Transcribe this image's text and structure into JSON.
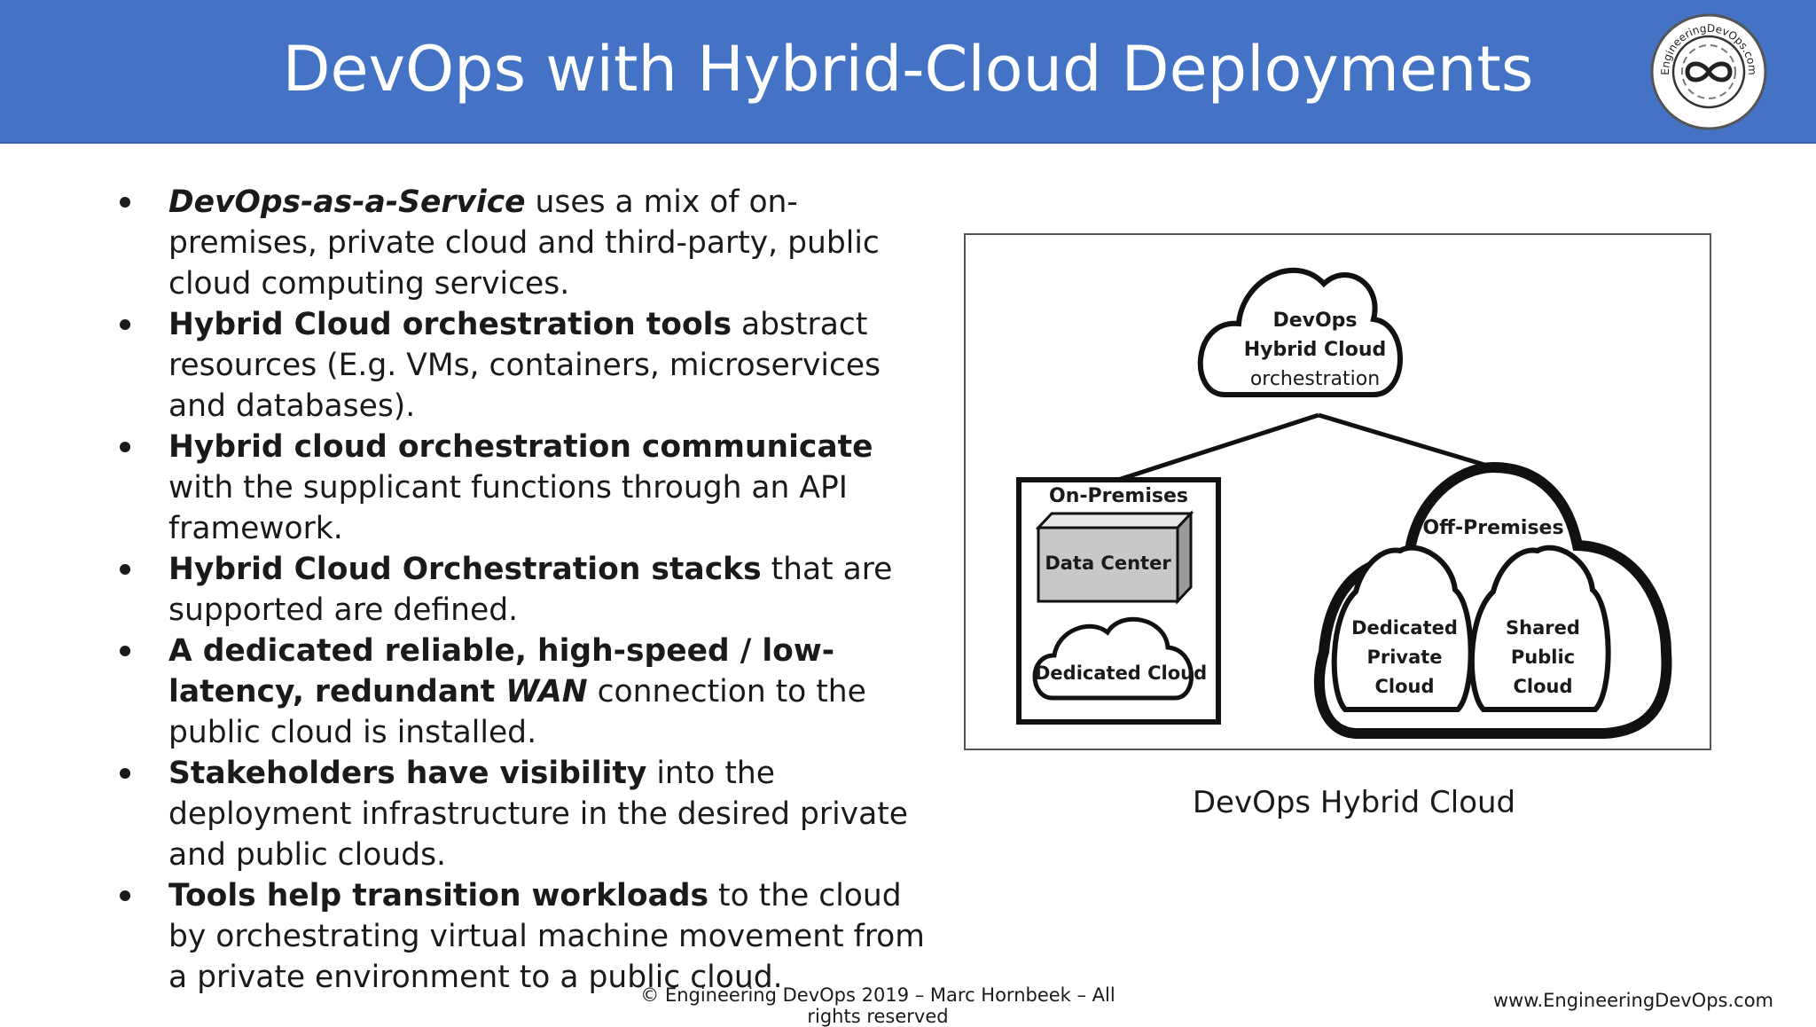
{
  "slide": {
    "title": "DevOps with Hybrid-Cloud Deployments",
    "logo": {
      "icon": "infinity-icon",
      "text": "EngineeringDevOps.com"
    },
    "bullets": [
      {
        "bold": "",
        "bold_italic": "DevOps-as-a-Service",
        "text": " uses a mix of on-premises, private cloud and third-party, public cloud computing services."
      },
      {
        "bold": "Hybrid Cloud orchestration tools",
        "text": " abstract resources (E.g. VMs, containers, microservices and databases)."
      },
      {
        "bold": "Hybrid cloud orchestration communicate",
        "text": " with the supplicant functions through an  API framework."
      },
      {
        "bold": "Hybrid Cloud Orchestration stacks",
        "text": " that are supported are defined."
      },
      {
        "bold": "A dedicated reliable, high-speed / low-latency, redundant ",
        "bold_italic": "WAN",
        "text": " connection to the public cloud is installed."
      },
      {
        "bold": "Stakeholders have visibility",
        "text": " into the deployment infrastructure in the desired private and public clouds."
      },
      {
        "bold": "Tools help transition workloads",
        "text": " to the cloud by orchestrating virtual machine movement from a private environment to a public cloud."
      }
    ],
    "diagram": {
      "top_cloud": [
        "DevOps",
        "Hybrid Cloud",
        "orchestration"
      ],
      "on_premises": "On-Premises",
      "data_center": "Data Center",
      "dedicated_cloud": "Dedicated Cloud",
      "off_premises": "Off-Premises",
      "dedicated_private_cloud": [
        "Dedicated",
        "Private",
        "Cloud"
      ],
      "shared_public_cloud": [
        "Shared",
        "Public",
        "Cloud"
      ]
    },
    "caption": "DevOps Hybrid Cloud",
    "footer_copyright": "© Engineering DevOps 2019 – Marc Hornbeek – All rights reserved",
    "footer_url": "www.EngineeringDevOps.com"
  }
}
